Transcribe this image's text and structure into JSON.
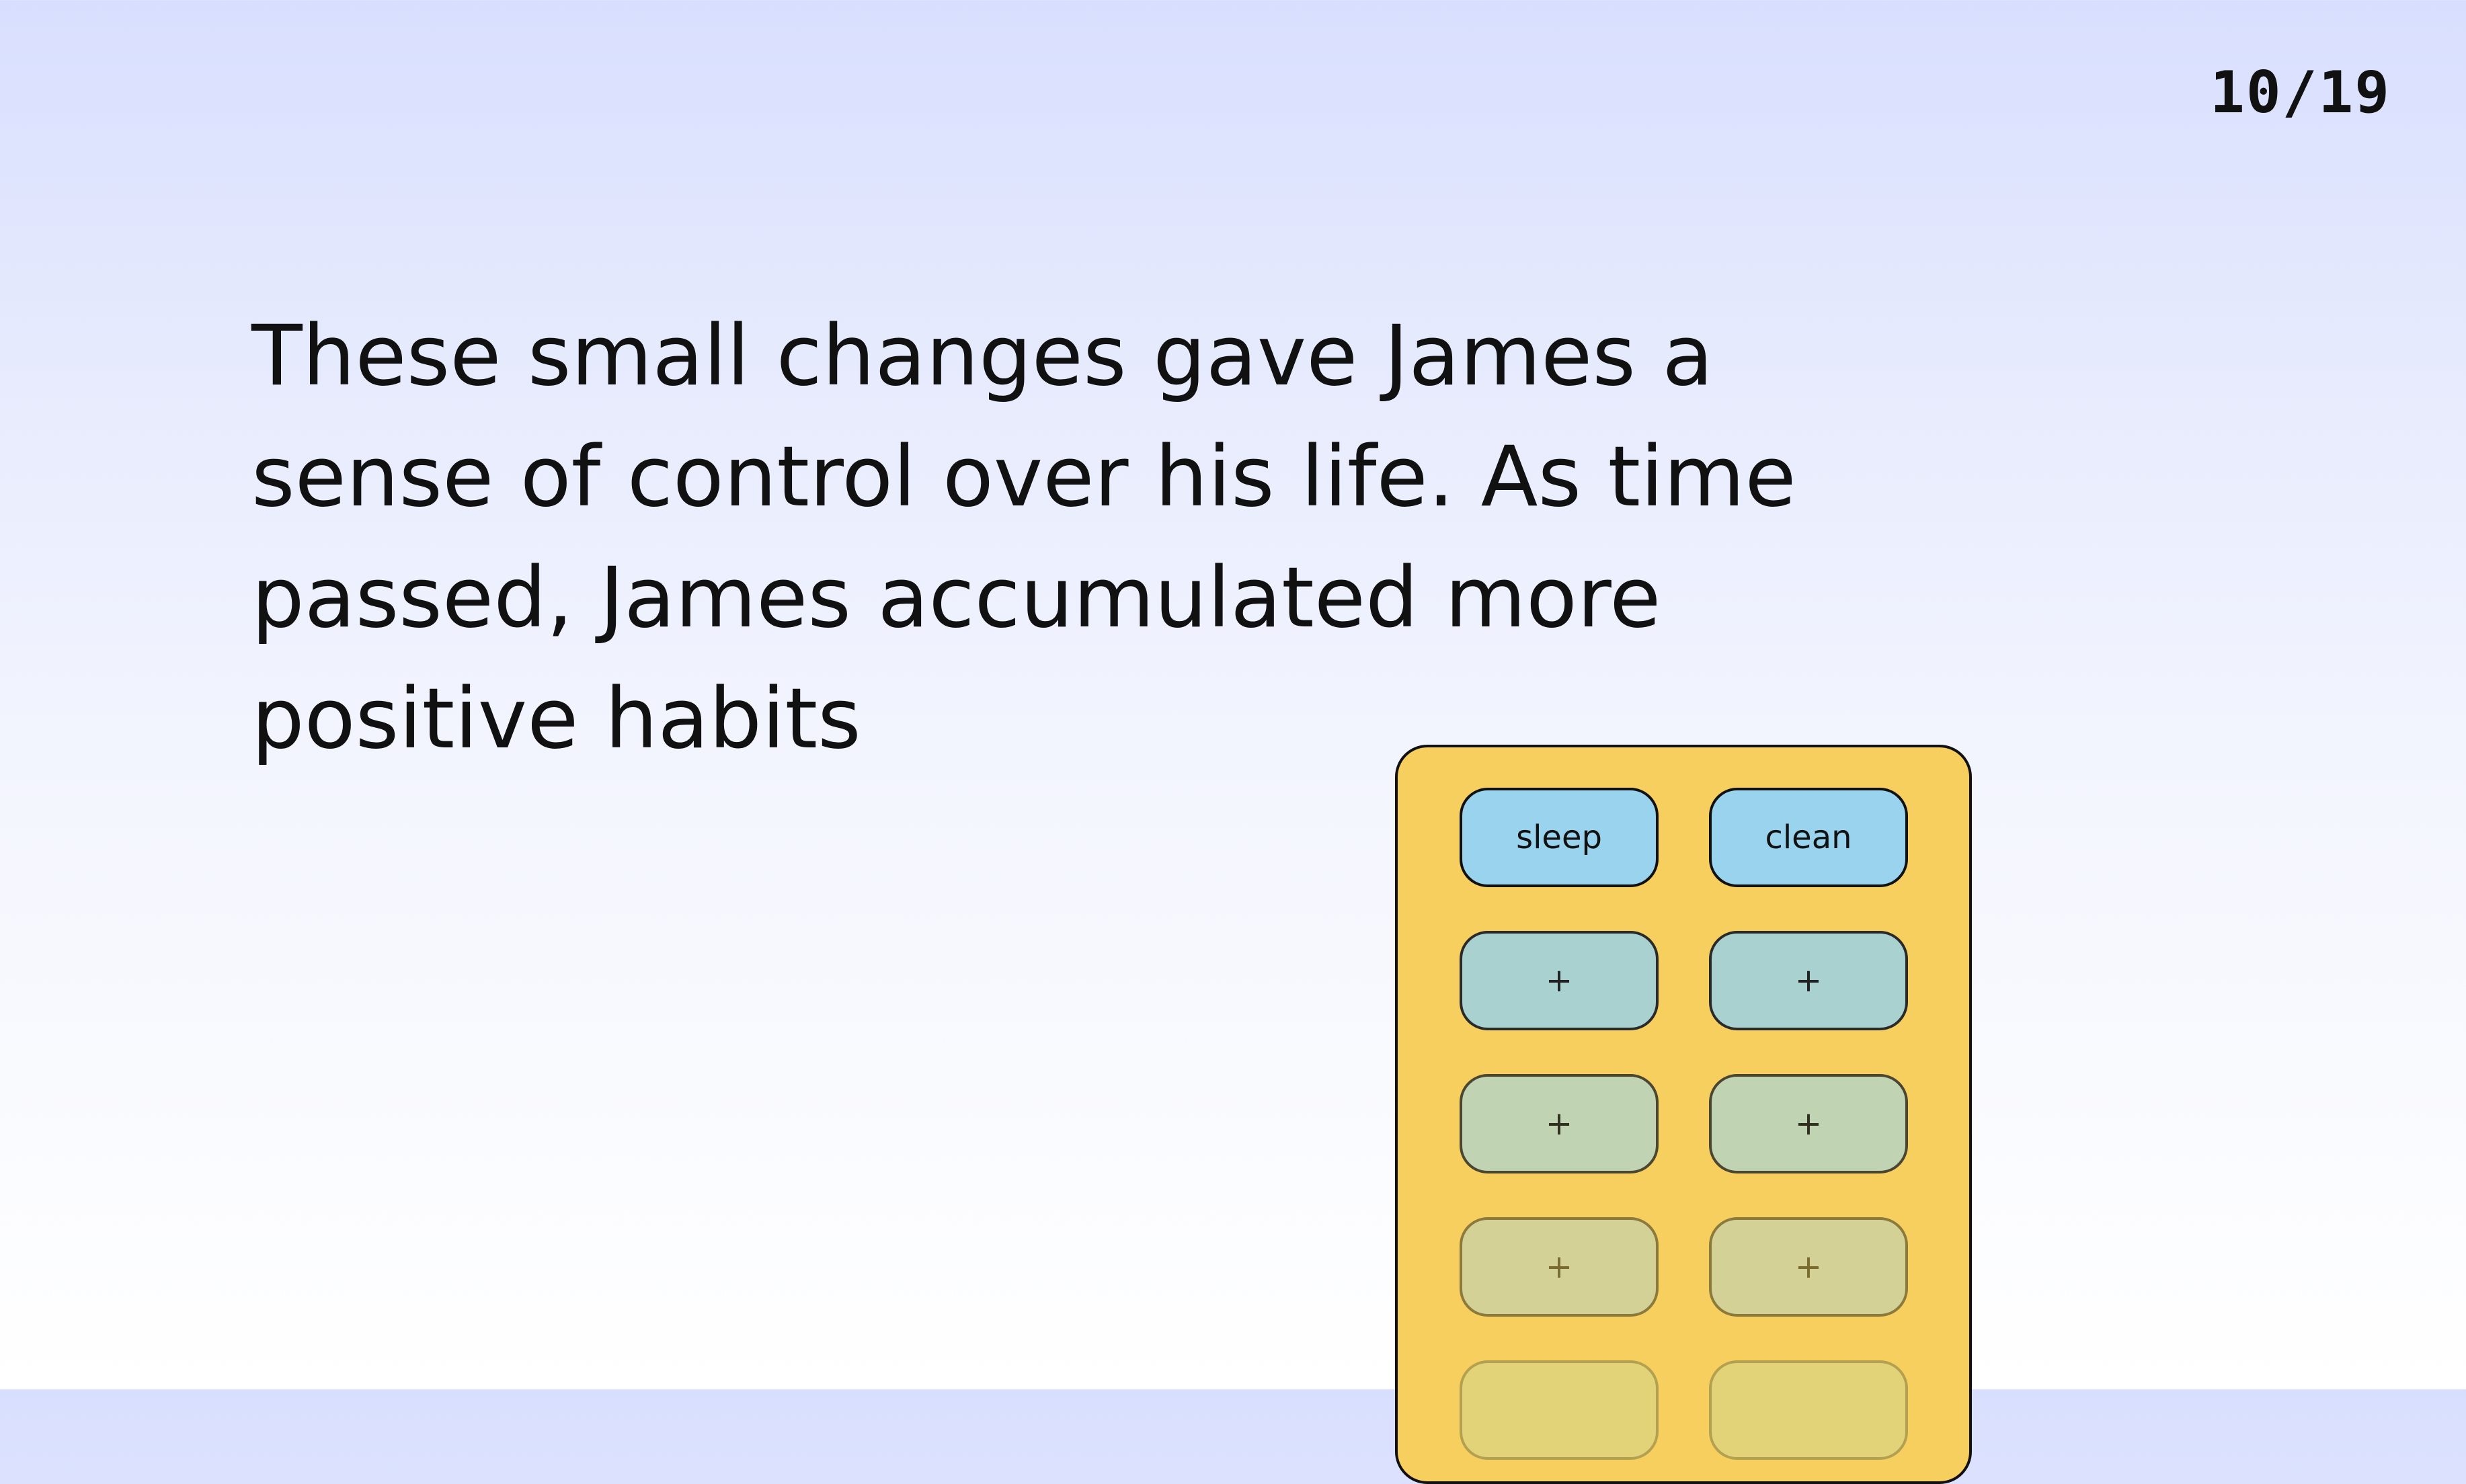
{
  "slide": {
    "counter": "10/19",
    "narration_lines": [
      "These small changes gave James a",
      "sense of control over his life. As time",
      "passed, James accumulated more",
      "positive habits"
    ]
  },
  "habit_board": {
    "slots": [
      {
        "label": "sleep",
        "filled": true
      },
      {
        "label": "clean",
        "filled": true
      },
      {
        "label": "+",
        "filled": false
      },
      {
        "label": "+",
        "filled": false
      },
      {
        "label": "+",
        "filled": false
      },
      {
        "label": "+",
        "filled": false
      },
      {
        "label": "+",
        "filled": false
      },
      {
        "label": "+",
        "filled": false
      },
      {
        "label": "",
        "filled": false
      },
      {
        "label": "",
        "filled": false
      }
    ]
  },
  "colors": {
    "board": "#f6cf5e",
    "filled_slot": "#9ad3ee",
    "text": "#111111"
  }
}
